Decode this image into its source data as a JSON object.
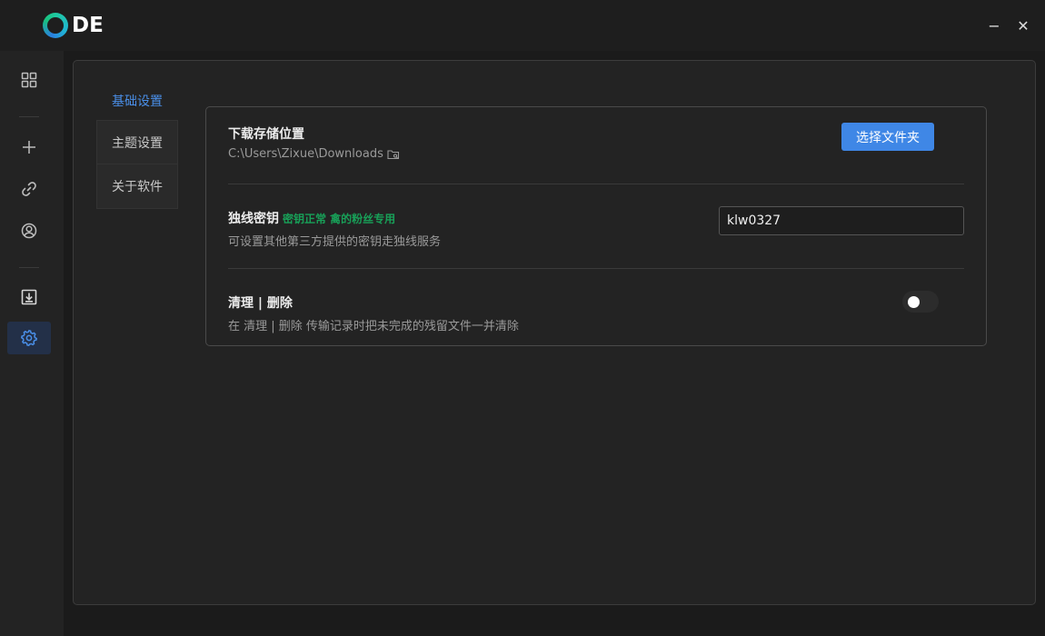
{
  "app": {
    "logo_text": "DE"
  },
  "window": {
    "minimize": "−",
    "close": "✕"
  },
  "sidebar": {
    "items": [
      {
        "icon": "grid-icon"
      },
      {
        "icon": "plus-icon"
      },
      {
        "icon": "link-icon"
      },
      {
        "icon": "user-circle-icon"
      },
      {
        "icon": "download-box-icon"
      },
      {
        "icon": "gear-icon",
        "active": true
      }
    ]
  },
  "tabs": [
    {
      "label": "基础设置",
      "active": true
    },
    {
      "label": "主题设置"
    },
    {
      "label": "关于软件"
    }
  ],
  "settings": {
    "download": {
      "title": "下载存储位置",
      "path": "C:\\Users\\Zixue\\Downloads",
      "button": "选择文件夹"
    },
    "key": {
      "title": "独线密钥",
      "status": "密钥正常 禽的粉丝专用",
      "desc": "可设置其他第三方提供的密钥走独线服务",
      "value": "klw0327"
    },
    "clean": {
      "title": "清理 | 删除",
      "desc": "在 清理 | 删除 传输记录时把未完成的残留文件一并清除",
      "enabled": false
    }
  },
  "colors": {
    "accent": "#3f87e6",
    "status_ok": "#18a058",
    "active_nav": "#233048"
  }
}
